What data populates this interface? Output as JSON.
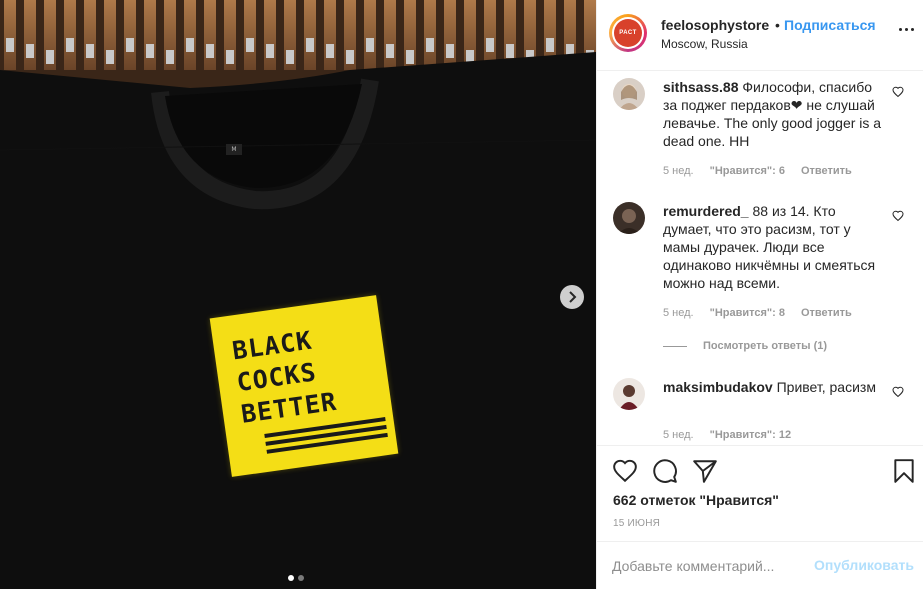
{
  "post": {
    "username": "feelosophystore",
    "follow_separator": "•",
    "follow_label": "Подписаться",
    "location": "Moscow, Russia",
    "avatar_text": "РАСТ",
    "more_icon": "more-horizontal-icon"
  },
  "photo": {
    "size_tag": "M",
    "print_lines": [
      "BLACK",
      "COCKS",
      "BETTER"
    ],
    "print_color": "#f4de16",
    "carousel": {
      "current": 1,
      "total": 2
    }
  },
  "comments": [
    {
      "username": "sithsass.88",
      "text": "Философи, спасибо за поджег пердаков❤ не слушай левачье. The only good jogger is a dead one. HH",
      "time": "5 нед.",
      "likes": "\"Нравится\": 6",
      "reply": "Ответить"
    },
    {
      "username": "remurdered_",
      "text": "88 из 14. Кто думает, что это расизм, тот у мамы дурачек. Люди все одинаково никчёмны и смеяться можно над всеми.",
      "time": "5 нед.",
      "likes": "\"Нравится\": 8",
      "reply": "Ответить"
    },
    {
      "username": "maksimbudakov",
      "text": "Привет, расизм",
      "time": "5 нед.",
      "likes": "\"Нравится\": 12",
      "reply": ""
    }
  ],
  "view_replies": "Посмотреть ответы (1)",
  "actions": {
    "likes": "662 отметок \"Нравится\"",
    "date": "15 ИЮНЯ"
  },
  "add_comment": {
    "placeholder": "Добавьте комментарий...",
    "publish": "Опубликовать"
  },
  "colors": {
    "link_blue": "#3897f0",
    "publish_disabled": "#b2dffc",
    "muted_text": "#999999"
  }
}
